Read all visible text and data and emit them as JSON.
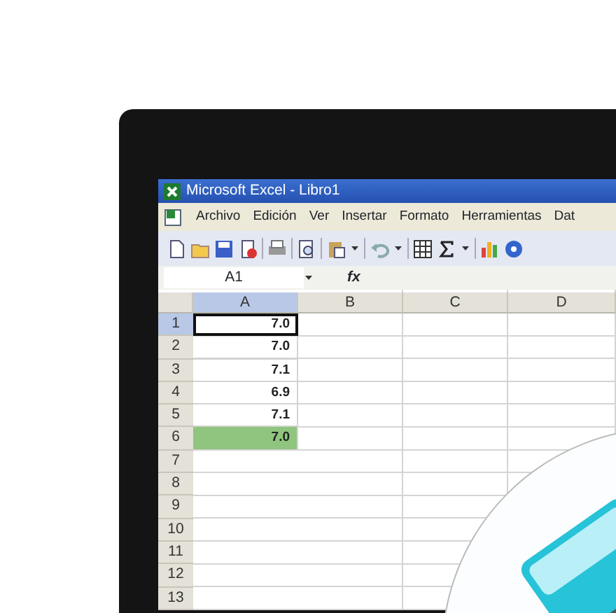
{
  "window": {
    "title": "Microsoft Excel - Libro1"
  },
  "menu": [
    {
      "label": "Archivo"
    },
    {
      "label": "Edición"
    },
    {
      "label": "Ver"
    },
    {
      "label": "Insertar"
    },
    {
      "label": "Formato"
    },
    {
      "label": "Herramientas"
    },
    {
      "label": "Dat"
    }
  ],
  "toolbar": [
    {
      "kind": "new"
    },
    {
      "kind": "open"
    },
    {
      "kind": "save"
    },
    {
      "kind": "permission"
    },
    {
      "kind": "sep"
    },
    {
      "kind": "print"
    },
    {
      "kind": "sep"
    },
    {
      "kind": "preview"
    },
    {
      "kind": "sep"
    },
    {
      "kind": "paste"
    },
    {
      "kind": "drop"
    },
    {
      "kind": "sep"
    },
    {
      "kind": "undo"
    },
    {
      "kind": "drop"
    },
    {
      "kind": "sep"
    },
    {
      "kind": "grid"
    },
    {
      "kind": "sum"
    },
    {
      "kind": "drop"
    },
    {
      "kind": "sep"
    },
    {
      "kind": "chart"
    },
    {
      "kind": "help"
    }
  ],
  "formula_bar": {
    "name_box": "A1",
    "function_label": "fx"
  },
  "columns": [
    {
      "label": "A",
      "selected": true
    },
    {
      "label": "B",
      "selected": false
    },
    {
      "label": "C",
      "selected": false
    },
    {
      "label": "D",
      "selected": false
    }
  ],
  "rows": [
    {
      "number": "1",
      "selected": true,
      "cells": [
        {
          "text": "7.0",
          "active": true,
          "highlighted": false
        }
      ]
    },
    {
      "number": "2",
      "selected": false,
      "cells": [
        {
          "text": "7.0",
          "active": false,
          "highlighted": false
        }
      ]
    },
    {
      "number": "3",
      "selected": false,
      "cells": [
        {
          "text": "7.1",
          "active": false,
          "highlighted": false
        }
      ]
    },
    {
      "number": "4",
      "selected": false,
      "cells": [
        {
          "text": "6.9",
          "active": false,
          "highlighted": false
        }
      ]
    },
    {
      "number": "5",
      "selected": false,
      "cells": [
        {
          "text": "7.1",
          "active": false,
          "highlighted": false
        }
      ]
    },
    {
      "number": "6",
      "selected": false,
      "cells": [
        {
          "text": "7.0",
          "active": false,
          "highlighted": true
        }
      ]
    },
    {
      "number": "7",
      "selected": false,
      "cells": []
    },
    {
      "number": "8",
      "selected": false,
      "cells": []
    },
    {
      "number": "9",
      "selected": false,
      "cells": []
    },
    {
      "number": "10",
      "selected": false,
      "cells": []
    },
    {
      "number": "11",
      "selected": false,
      "cells": []
    },
    {
      "number": "12",
      "selected": false,
      "cells": []
    },
    {
      "number": "13",
      "selected": false,
      "cells": []
    }
  ]
}
